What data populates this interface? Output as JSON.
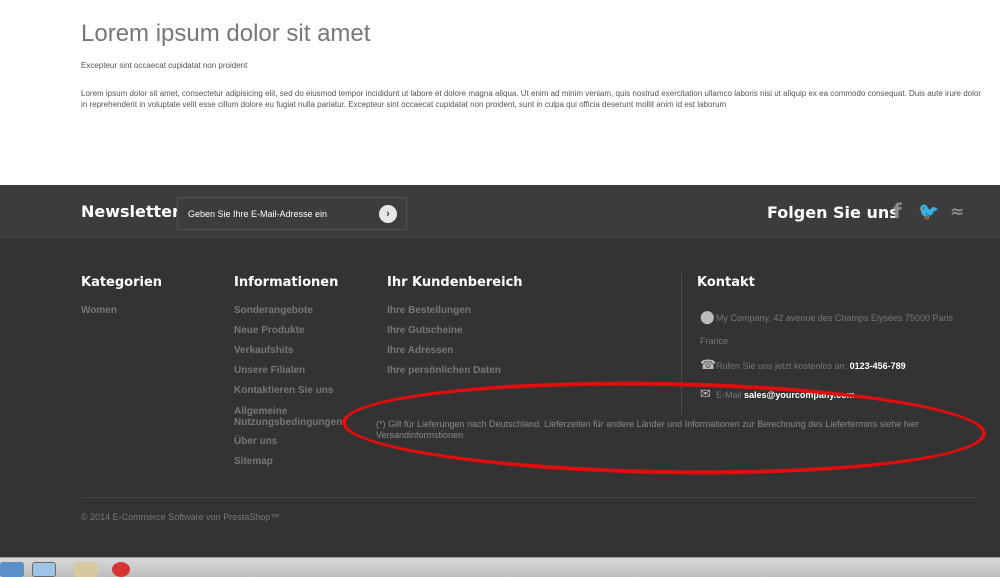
{
  "content": {
    "title": "Lorem ipsum dolor sit amet",
    "subtitle": "Excepteur sint occaecat cupidatat non proident",
    "paragraph": "Lorem ipsum dolor sit amet, consectetur adipisicing elit, sed do eiusmod tempor incididunt ut labore et dolore magna aliqua. Ut enim ad minim veniam, quis nostrud exercitation ullamco laboris nisi ut aliquip ex ea commodo consequat. Duis aute irure dolor in reprehenderit in voluptate velit esse cillum dolore eu fugiat nulla pariatur. Excepteur sint occaecat cupidatat non proident, sunt in culpa qui officia deserunt mollit anim id est laborum"
  },
  "newsletter": {
    "title": "Newsletter",
    "placeholder": "Geben Sie Ihre E-Mail-Adresse ein",
    "submit_icon": "arrow-right-circle-icon"
  },
  "social": {
    "title": "Folgen Sie uns",
    "icons": [
      "facebook-icon",
      "twitter-icon",
      "rss-icon"
    ]
  },
  "footer": {
    "categories": {
      "title": "Kategorien",
      "items": [
        "Women"
      ]
    },
    "information": {
      "title": "Informationen",
      "items": [
        "Sonderangebote",
        "Neue Produkte",
        "Verkaufshits",
        "Unsere Filialen",
        "Kontaktieren Sie uns",
        "Allgemeine Nutzungsbedingungen",
        "Über uns",
        "Sitemap"
      ]
    },
    "account": {
      "title": "Ihr Kundenbereich",
      "items": [
        "Ihre Bestellungen",
        "Ihre Gutscheine",
        "Ihre Adressen",
        "Ihre persönlichen Daten"
      ]
    },
    "contact": {
      "title": "Kontakt",
      "address": "My Company, 42 avenue des Champs Elysées 75000 Paris France",
      "phone_label": "Rufen Sie uns jetzt kostenlos an:",
      "phone": "0123-456-789",
      "email_label": "E-Mail",
      "email": "sales@yourcompany.com"
    },
    "note": "(*) Gilt für Lieferungen nach Deutschland. Lieferzeiten für andere Länder und Informationen zur Berechnung des Liefertermins siehe hier Versandinformstionen",
    "copyright": "© 2014 E-Commerce Software von PrestaShop™"
  },
  "colors": {
    "annotation_oval": "#e30d0d",
    "footer_bg": "#333333",
    "newsletter_bg": "#3c3c3c"
  }
}
